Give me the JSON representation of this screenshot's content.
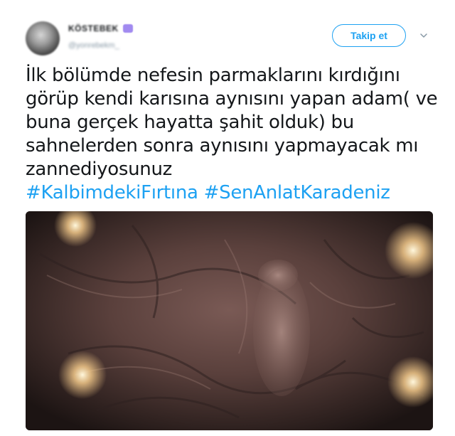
{
  "author": {
    "display_name": "KÖSTEBEK",
    "handle": "@yonrebekm_"
  },
  "follow_button": {
    "label": "Takip et"
  },
  "more_menu_icon": "chevron-down-icon",
  "tweet": {
    "lines": [
      "İlk bölümde nefesin parmaklarını kırdığını",
      "görüp kendi karısına aynısını yapan adam( ve",
      "buna gerçek hayatta şahit olduk) bu",
      "sahnelerden sonra aynısını yapmayacak mı",
      "zannediyosunuz"
    ],
    "hashtags": [
      "#KalbimdekiFırtına",
      "#SenAnlatKaradeniz"
    ]
  },
  "colors": {
    "accent": "#1da1f2",
    "text": "#14171a",
    "muted": "#8899a6"
  }
}
